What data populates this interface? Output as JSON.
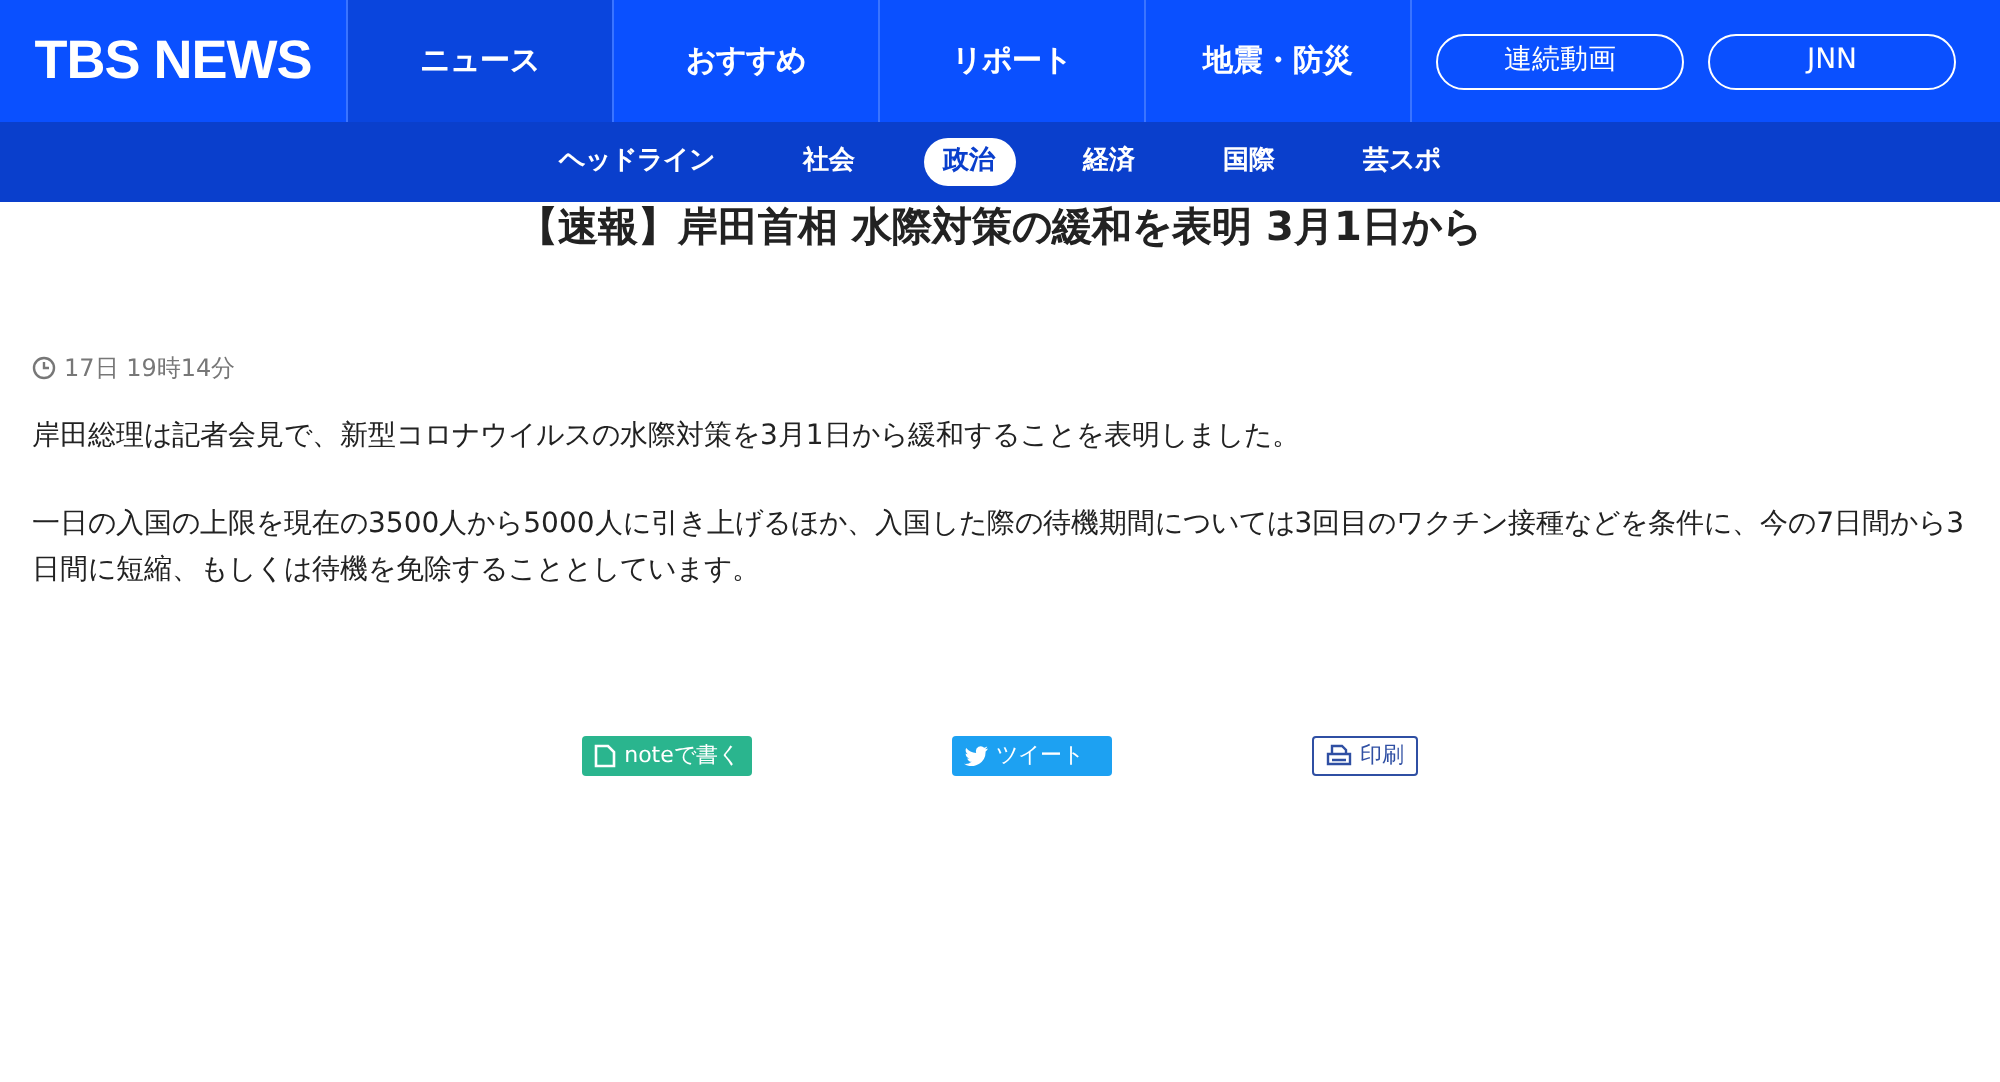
{
  "header": {
    "logo": "TBS NEWS",
    "tabs": [
      {
        "label": "ニュース",
        "selected": true
      },
      {
        "label": "おすすめ",
        "selected": false
      },
      {
        "label": "リポート",
        "selected": false
      },
      {
        "label": "地震・防災",
        "selected": false
      }
    ],
    "links": [
      "連続動画",
      "JNN"
    ]
  },
  "subnav": [
    {
      "label": "ヘッドライン",
      "selected": false
    },
    {
      "label": "社会",
      "selected": false
    },
    {
      "label": "政治",
      "selected": true
    },
    {
      "label": "経済",
      "selected": false
    },
    {
      "label": "国際",
      "selected": false
    },
    {
      "label": "芸スポ",
      "selected": false
    }
  ],
  "article": {
    "title": "【速報】岸田首相 水際対策の緩和を表明 3月1日から",
    "time": "17日 19時14分",
    "paragraphs": [
      "岸田総理は記者会見で、新型コロナウイルスの水際対策を3月1日から緩和することを表明しました。",
      "一日の入国の上限を現在の3500人から5000人に引き上げるほか、入国した際の待機期間については3回目のワクチン接種などを条件に、今の7日間から3日間に短縮、もしくは待機を免除することとしています。"
    ]
  },
  "share": [
    {
      "kind": "note",
      "label": "noteで書く"
    },
    {
      "kind": "tweet",
      "label": "ツイート"
    },
    {
      "kind": "print",
      "label": "印刷"
    }
  ]
}
